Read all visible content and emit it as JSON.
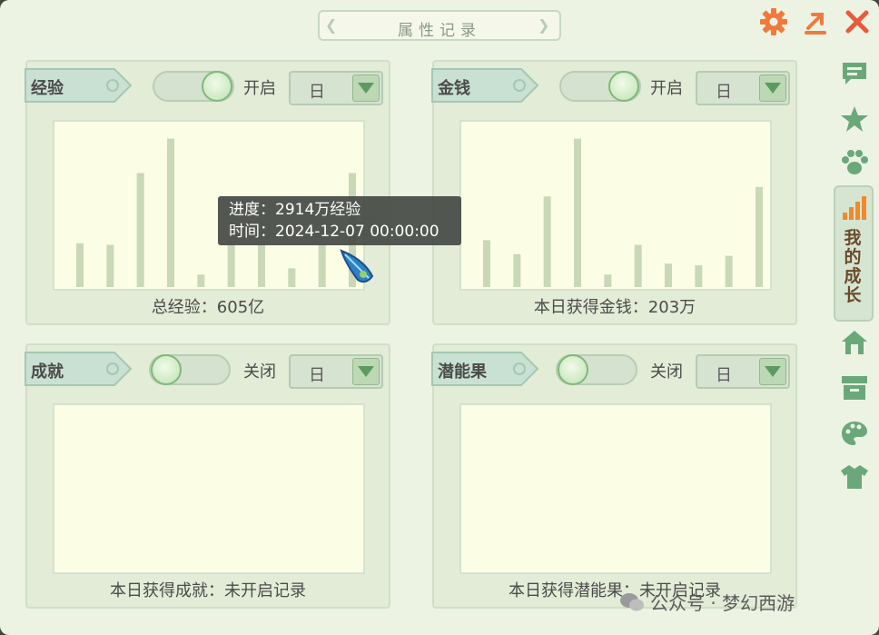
{
  "window": {
    "title": "属性记录"
  },
  "colors": {
    "accent_orange": "#f07a3c",
    "close_red": "#e85a3a",
    "panel_bg": "#e2ecd7",
    "chart_bg": "#fbfde4",
    "bar": "#c9d8b7",
    "icon_green": "#6aa87a"
  },
  "panels": [
    {
      "title": "经验",
      "toggle": {
        "state": "on",
        "label": "开启"
      },
      "select": "日",
      "summary": "总经验：605亿",
      "chart_data": {
        "type": "bar",
        "values": [
          28,
          27,
          73,
          95,
          8,
          30,
          27,
          12,
          27,
          73
        ]
      }
    },
    {
      "title": "金钱",
      "toggle": {
        "state": "on",
        "label": "开启"
      },
      "select": "日",
      "summary": "本日获得金钱：203万",
      "chart_data": {
        "type": "bar",
        "values": [
          30,
          21,
          58,
          95,
          8,
          27,
          15,
          14,
          20,
          64
        ]
      }
    },
    {
      "title": "成就",
      "toggle": {
        "state": "off",
        "label": "关闭"
      },
      "select": "日",
      "summary": "本日获得成就：未开启记录"
    },
    {
      "title": "潜能果",
      "toggle": {
        "state": "off",
        "label": "关闭"
      },
      "select": "日",
      "summary": "本日获得潜能果：未开启记录"
    }
  ],
  "tooltip": {
    "progress": "进度：2914万经验",
    "time": "时间：2024-12-07 00:00:00"
  },
  "sidebar": {
    "icons": [
      "message-icon",
      "star-icon",
      "paw-icon",
      "signal-icon",
      "home-icon",
      "archive-icon",
      "palette-icon",
      "shirt-icon"
    ],
    "growth_tab": "我的成长"
  },
  "watermark": "公众号 · 梦幻西游"
}
